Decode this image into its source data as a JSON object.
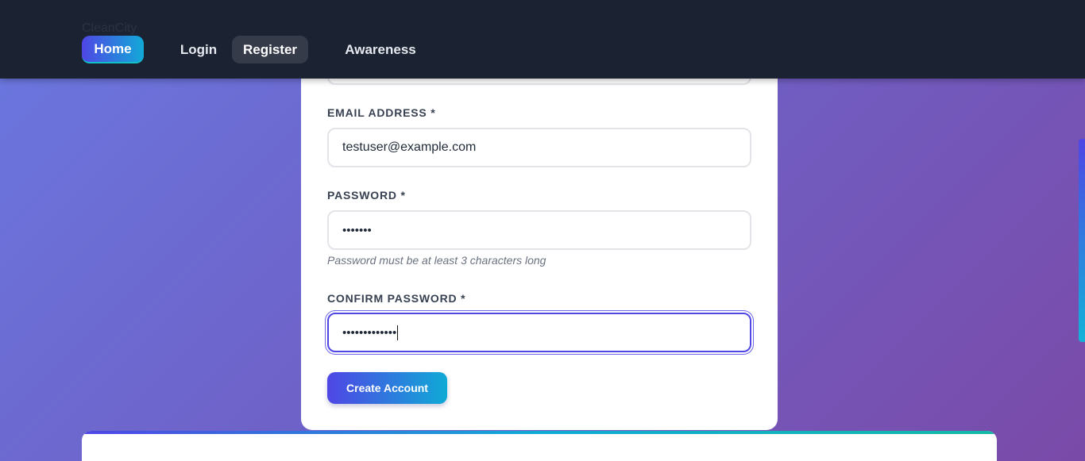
{
  "nav": {
    "brand": "CleanCity",
    "home": "Home",
    "login": "Login",
    "register": "Register",
    "awareness": "Awareness"
  },
  "form": {
    "email_label": "EMAIL ADDRESS *",
    "email_value": "testuser@example.com",
    "password_label": "PASSWORD *",
    "password_value": "•••••••",
    "password_hint": "Password must be at least 3 characters long",
    "confirm_label": "CONFIRM PASSWORD *",
    "confirm_value": "•••••••••••••",
    "submit_label": "Create Account"
  },
  "colors": {
    "accent": "#4f46e5",
    "accent_2": "#12a9d8",
    "navbar": "#1b2231"
  }
}
